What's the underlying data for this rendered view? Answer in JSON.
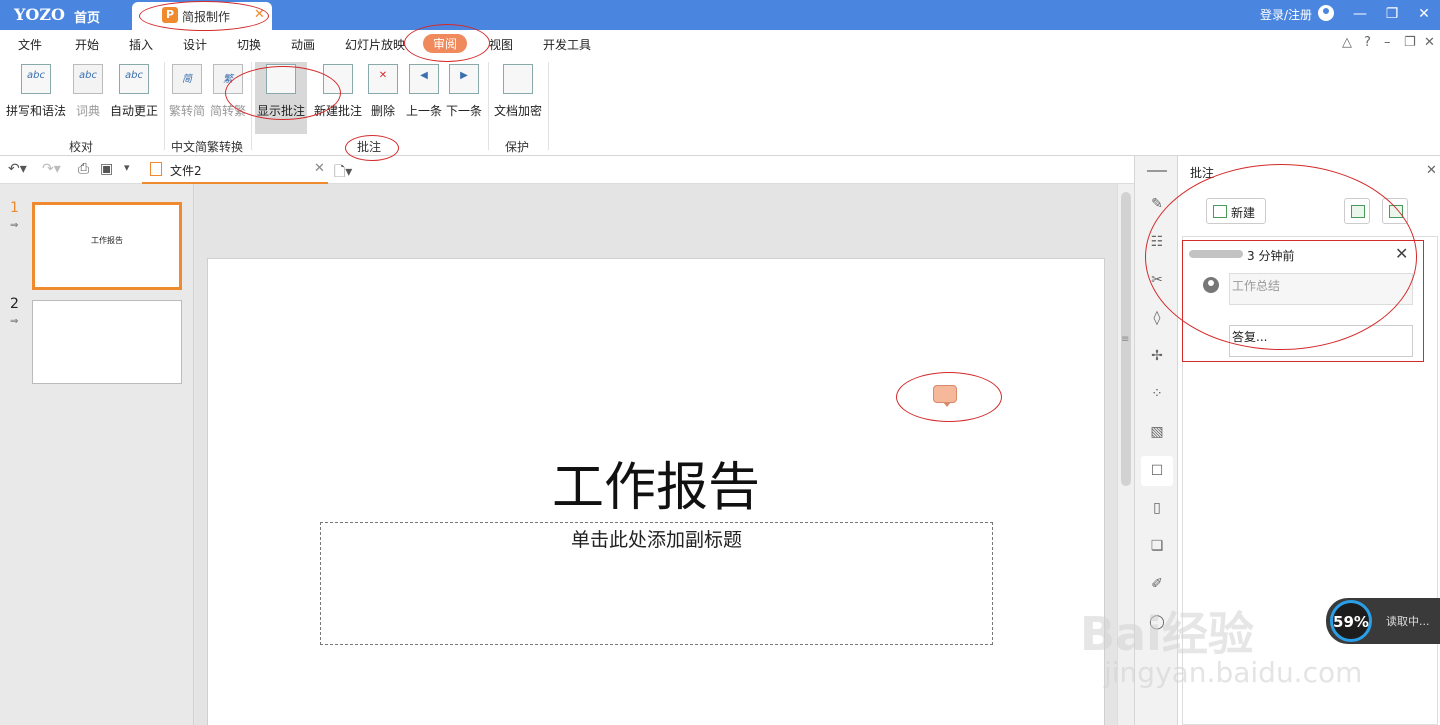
{
  "titlebar": {
    "logo": "YOZO",
    "home": "首页",
    "doc_tab": "简报制作",
    "doc_tab_icon": "P",
    "login": "登录/注册"
  },
  "menu": {
    "items": [
      "文件",
      "开始",
      "插入",
      "设计",
      "切换",
      "动画",
      "幻灯片放映",
      "审阅",
      "视图",
      "开发工具"
    ],
    "active": "审阅"
  },
  "ribbon": {
    "buttons": [
      {
        "label": "拼写和语法",
        "glyph": "abc"
      },
      {
        "label": "词典",
        "glyph": "abc"
      },
      {
        "label": "自动更正",
        "glyph": "abc"
      },
      {
        "label": "繁转简",
        "glyph": "简"
      },
      {
        "label": "简转繁",
        "glyph": "繁"
      },
      {
        "label": "显示批注",
        "glyph": ""
      },
      {
        "label": "新建批注",
        "glyph": ""
      },
      {
        "label": "删除",
        "glyph": "✕"
      },
      {
        "label": "上一条",
        "glyph": "◀"
      },
      {
        "label": "下一条",
        "glyph": "▶"
      },
      {
        "label": "文档加密",
        "glyph": ""
      }
    ],
    "groups": [
      "校对",
      "中文简繁转换",
      "批注",
      "保护"
    ]
  },
  "toolbar": {
    "file_tab": "文件2"
  },
  "thumbnails": {
    "items": [
      {
        "num": "1",
        "title": "工作报告"
      },
      {
        "num": "2",
        "title": ""
      }
    ]
  },
  "slide": {
    "title": "工作报告",
    "subtitle": "单击此处添加副标题"
  },
  "panel": {
    "title": "批注",
    "new_label": "新建",
    "comment": {
      "time": "3 分钟前",
      "text": "工作总结",
      "reply": "答复..."
    }
  },
  "loader": {
    "percent": "59%",
    "text": "读取中..."
  },
  "watermark": {
    "brand": "Bai经验",
    "url": "jingyan.baidu.com"
  },
  "colors": {
    "titlebar": "#4a86e0",
    "accent": "#f08a2e",
    "active_menu": "#f08a5d",
    "annotation": "#d42a2a"
  }
}
